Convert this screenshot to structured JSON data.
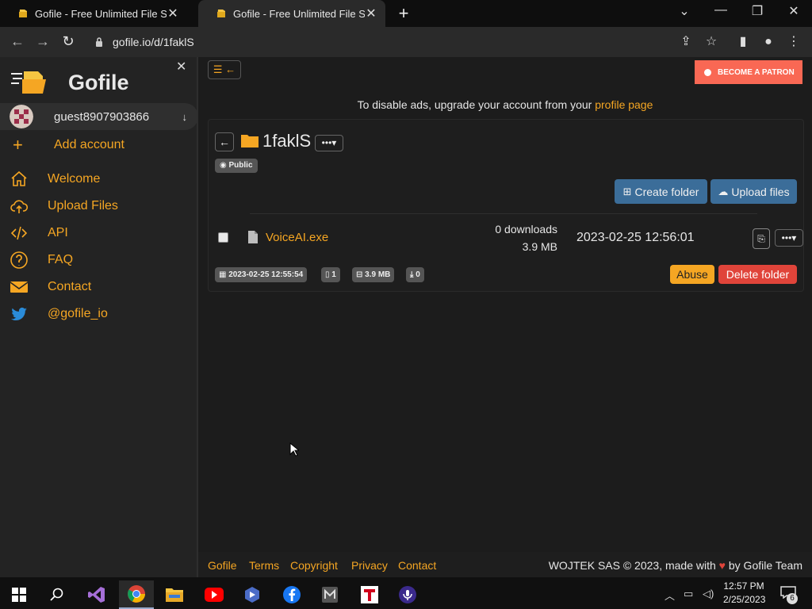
{
  "browser": {
    "tabs": [
      {
        "title": "Gofile - Free Unlimited File Sharing",
        "active": false
      },
      {
        "title": "Gofile - Free Unlimited File Sharing",
        "active": true
      }
    ],
    "url": "gofile.io/d/1faklS"
  },
  "sidebar": {
    "brand": "Gofile",
    "account": "guest8907903866",
    "add_account": "Add account",
    "items": [
      {
        "label": "Welcome",
        "icon": "home-icon"
      },
      {
        "label": "Upload Files",
        "icon": "cloud-upload-icon"
      },
      {
        "label": "API",
        "icon": "code-icon"
      },
      {
        "label": "FAQ",
        "icon": "question-icon"
      },
      {
        "label": "Contact",
        "icon": "envelope-icon"
      },
      {
        "label": "@gofile_io",
        "icon": "twitter-icon"
      }
    ]
  },
  "main": {
    "patron_button": "BECOME A PATRON",
    "ad_note_text": "To disable ads, upgrade your account from your",
    "ad_note_link": "profile page",
    "folder": {
      "name": "1faklS",
      "visibility": "Public",
      "create_folder": "Create folder",
      "upload_files": "Upload files"
    },
    "file": {
      "name": "VoiceAI.exe",
      "downloads": "0 downloads",
      "size": "3.9 MB",
      "date": "2023-02-25 12:56:01"
    },
    "stats": {
      "created": "2023-02-25 12:55:54",
      "files": "1",
      "size": "3.9 MB",
      "downloads": "0"
    },
    "abuse_button": "Abuse",
    "delete_button": "Delete folder"
  },
  "footer": {
    "links": [
      "Gofile",
      "Terms",
      "Copyright",
      "Privacy",
      "Contact"
    ],
    "copyright_prefix": "WOJTEK SAS © 2023, made with",
    "copyright_suffix": "by Gofile Team"
  },
  "taskbar": {
    "time": "12:57 PM",
    "date": "2/25/2023",
    "notifications": "6"
  },
  "colors": {
    "accent": "#f5a623",
    "primary_button": "#3b6d99",
    "danger": "#e0443a",
    "patron": "#f96854"
  }
}
